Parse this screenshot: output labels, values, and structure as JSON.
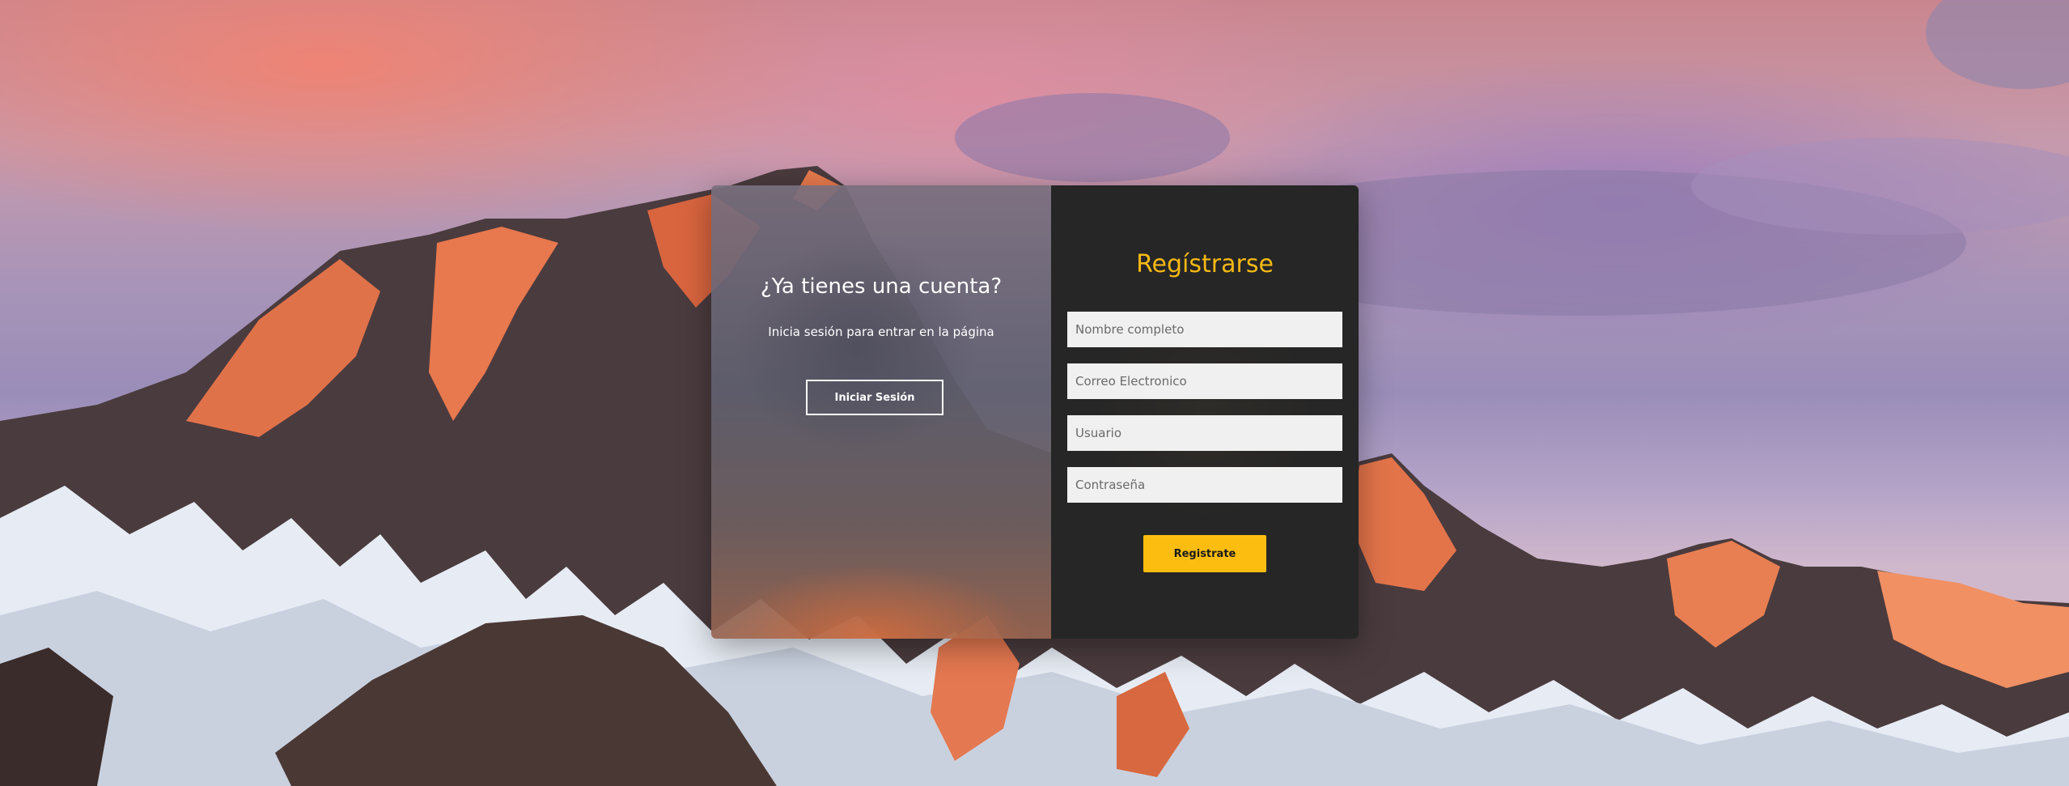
{
  "colors": {
    "accent": "#fdbd10",
    "right_panel_bg": "#262626",
    "title_accent": "#f5b915"
  },
  "login_panel": {
    "title": "¿Ya tienes una cuenta?",
    "subtitle": "Inicia sesión para entrar en la página",
    "button_label": "Iniciar Sesión"
  },
  "register_panel": {
    "title": "Regístrarse",
    "fields": {
      "full_name_placeholder": "Nombre completo",
      "email_placeholder": "Correo Electronico",
      "username_placeholder": "Usuario",
      "password_placeholder": "Contraseña"
    },
    "button_label": "Registrate"
  }
}
